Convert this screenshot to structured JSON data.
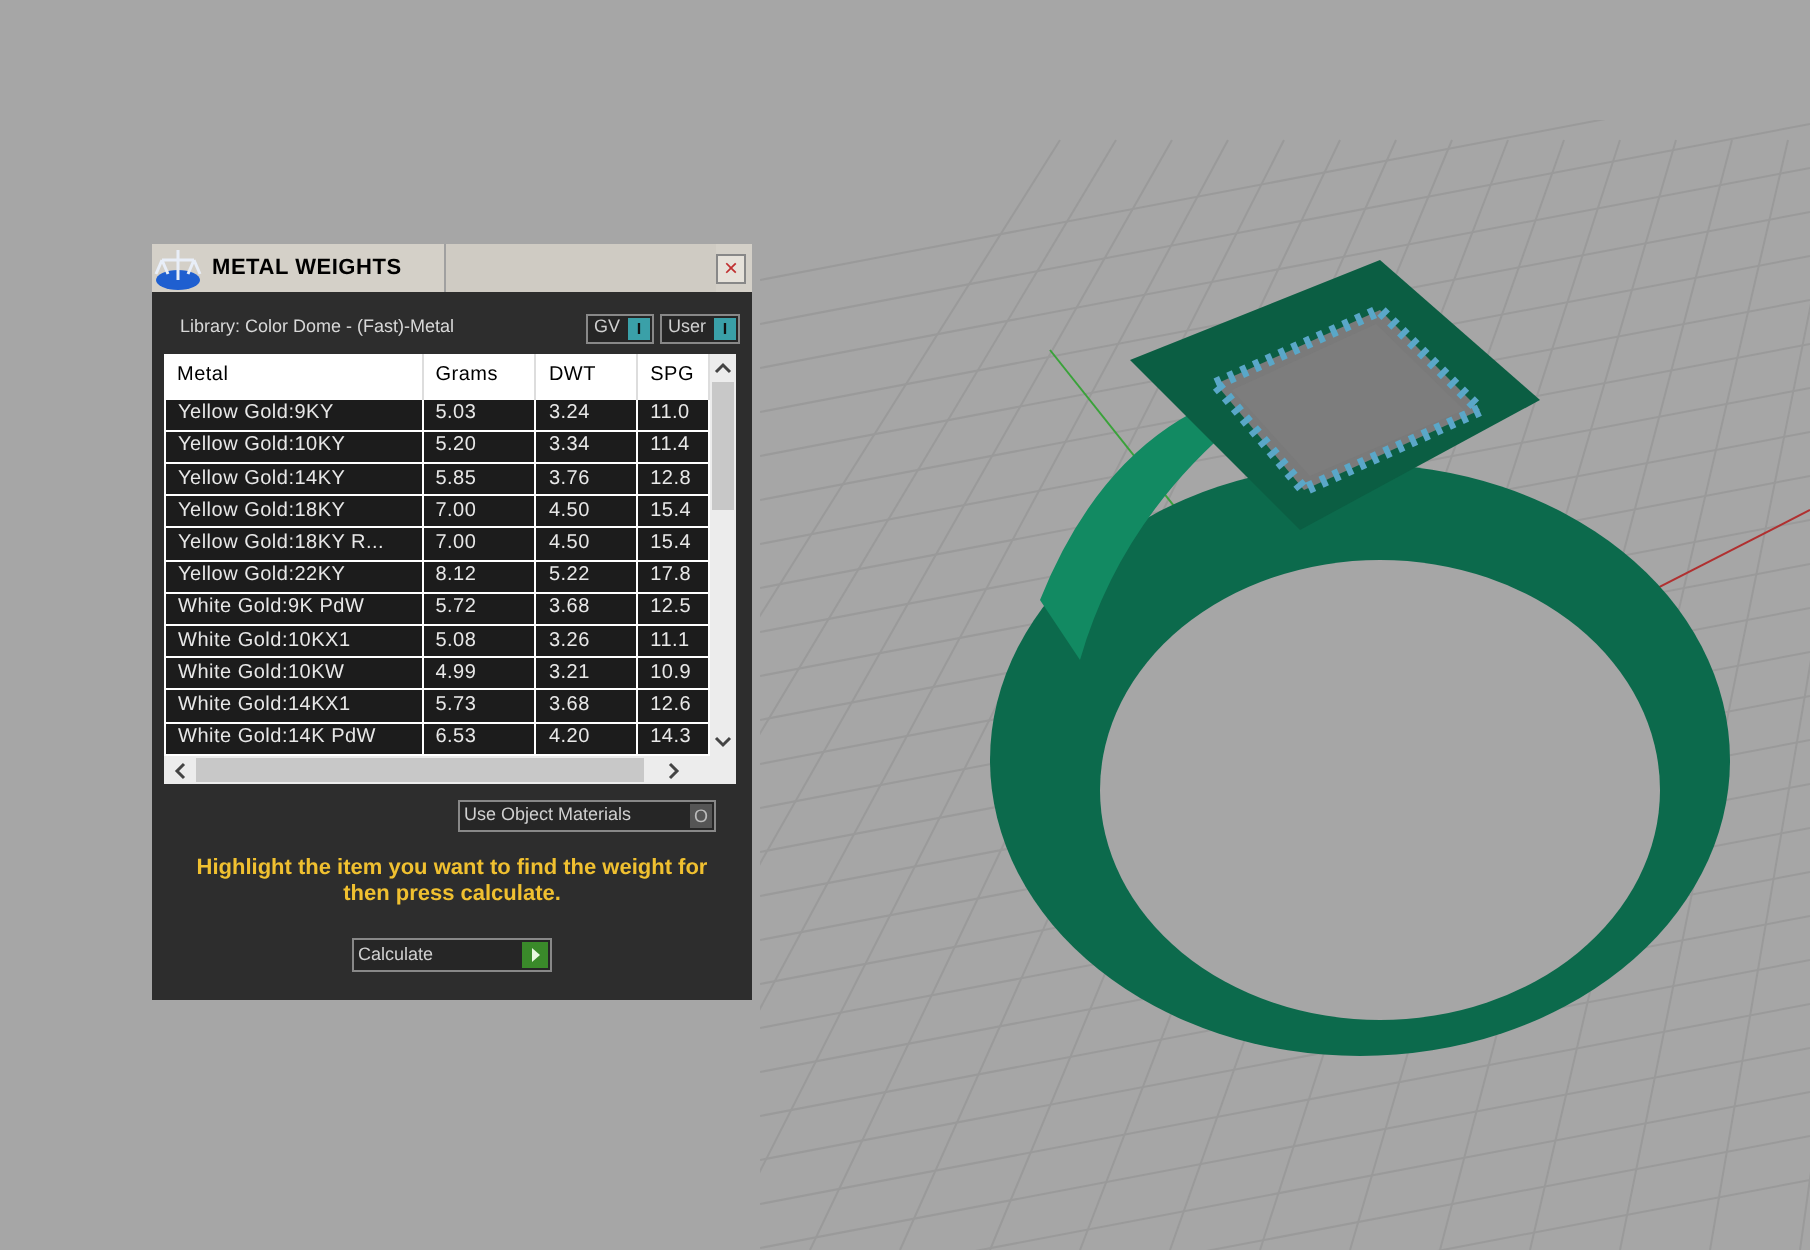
{
  "window": {
    "title": "METAL WEIGHTS",
    "close": "×"
  },
  "library": "Library: Color Dome - (Fast)-Metal",
  "toggles": [
    {
      "label": "GV",
      "indicator": "I",
      "on": true
    },
    {
      "label": "User",
      "indicator": "I",
      "on": true
    }
  ],
  "table": {
    "columns": [
      "Metal",
      "Grams",
      "DWT",
      "SPG"
    ],
    "rows": [
      [
        "Yellow Gold:9KY",
        "5.03",
        "3.24",
        "11.0"
      ],
      [
        "Yellow Gold:10KY",
        "5.20",
        "3.34",
        "11.4"
      ],
      [
        "Yellow Gold:14KY",
        "5.85",
        "3.76",
        "12.8"
      ],
      [
        "Yellow Gold:18KY",
        "7.00",
        "4.50",
        "15.4"
      ],
      [
        "Yellow Gold:18KY R...",
        "7.00",
        "4.50",
        "15.4"
      ],
      [
        "Yellow Gold:22KY",
        "8.12",
        "5.22",
        "17.8"
      ],
      [
        "White Gold:9K PdW",
        "5.72",
        "3.68",
        "12.5"
      ],
      [
        "White Gold:10KX1",
        "5.08",
        "3.26",
        "11.1"
      ],
      [
        "White Gold:10KW",
        "4.99",
        "3.21",
        "10.9"
      ],
      [
        "White Gold:14KX1",
        "5.73",
        "3.68",
        "12.6"
      ],
      [
        "White Gold:14K PdW",
        "6.53",
        "4.20",
        "14.3"
      ]
    ]
  },
  "use_object_materials": {
    "label": "Use Object Materials",
    "indicator": "O",
    "on": false
  },
  "hint": "Highlight the item you want to find the weight for then press calculate.",
  "calculate_button": "Calculate"
}
